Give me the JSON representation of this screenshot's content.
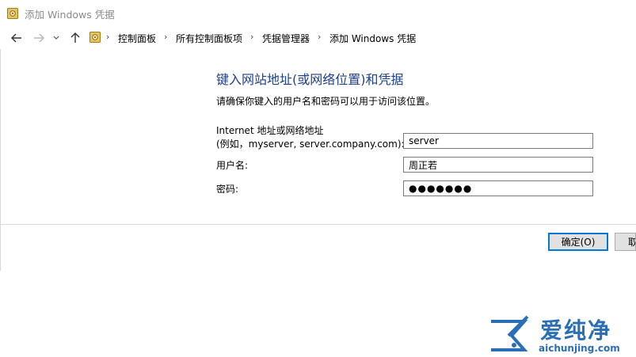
{
  "window": {
    "title": "添加 Windows 凭据"
  },
  "nav": {
    "back_icon": "arrow-left-icon",
    "forward_icon": "arrow-right-icon",
    "recent_icon": "chevron-down-icon",
    "up_icon": "arrow-up-icon",
    "breadcrumbs": [
      "控制面板",
      "所有控制面板项",
      "凭据管理器",
      "添加 Windows 凭据"
    ],
    "separator": "›"
  },
  "main": {
    "heading": "键入网站地址(或网络位置)和凭据",
    "description": "请确保你键入的用户名和密码可以用于访问该位置。",
    "address_label_line1": "Internet 地址或网络地址",
    "address_label_line2": "(例如，myserver, server.company.com):",
    "address_value": "server",
    "username_label": "用户名:",
    "username_value": "周正若",
    "password_label": "密码:",
    "password_value": "●●●●●●●"
  },
  "buttons": {
    "ok": "确定(O)",
    "cancel": "取"
  },
  "watermark": {
    "brand": "爱纯净",
    "url": "aichunjing.com"
  },
  "colors": {
    "heading": "#1e3f8a",
    "accent": "#0078d7",
    "watermark": "#2a6fb5"
  }
}
